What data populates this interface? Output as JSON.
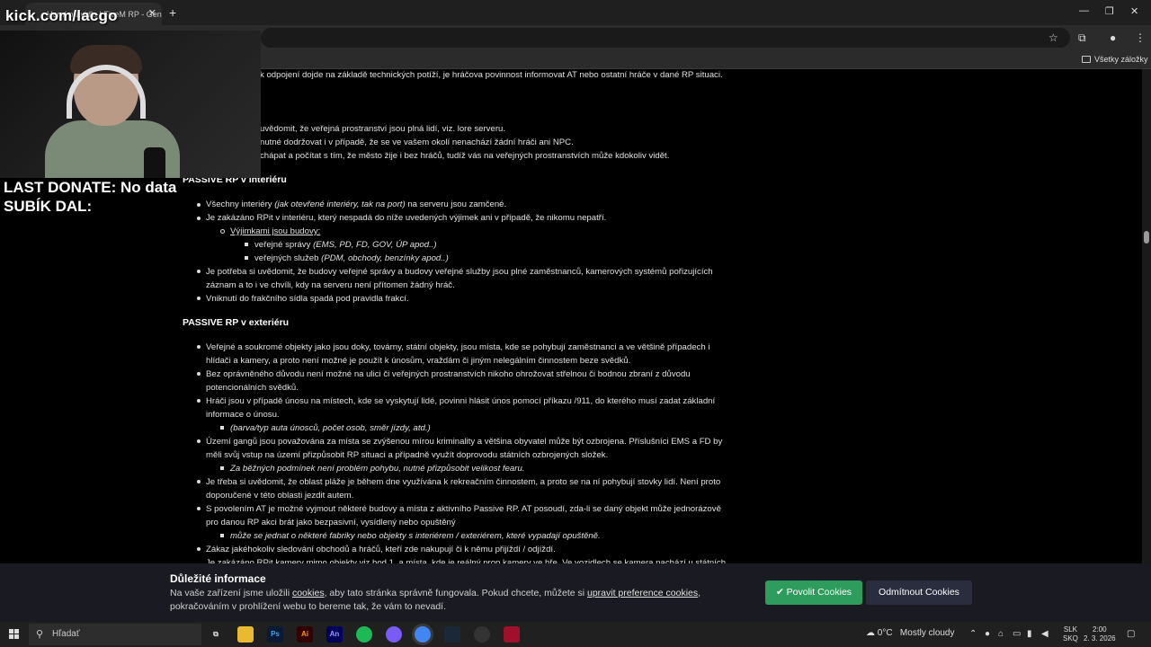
{
  "browser": {
    "tab_title": "Herní pravidla | FiveM RP - Gen",
    "bookmarks_all": "Všetky záložky"
  },
  "overlay": {
    "channel": "kick.com/lacgo",
    "donate_line": "LAST DONATE: No data",
    "sub_line": "SUBÍK DAL:"
  },
  "article": {
    "top_line": "k odpojení dojde na základě technických potíží, je hráčova povinnost informovat AT nebo ostatní hráče v dané RP situaci.",
    "public_lines": [
      "uvědomit, že veřejná prostranství jsou plná lidí, viz. lore serveru.",
      "nutné dodržovat i v případě, že se ve vašem okolí nenachází žádní hráči ani NPC.",
      "chápat a počítat s tím, že město žije i bez hráčů, tudíž vás na veřejných prostranstvích může kdokoliv vidět."
    ],
    "interior_heading": "PASSIVE RP v interiéru",
    "interior": {
      "b1_text": "Všechny interiéry ",
      "b1_italic": "(jak otevřené interiéry, tak na port)",
      "b1_tail": " na serveru jsou zamčené.",
      "b2": "Je zakázáno RPit v interiéru, který nespadá do níže uvedených výjimek ani v případě, že nikomu nepatří.",
      "exceptions_label": "Výjimkami jsou budovy:",
      "ex1_text": "veřejné správy ",
      "ex1_italic": "(EMS, PD, FD, GOV, ÚP apod..)",
      "ex2_text": "veřejných služeb ",
      "ex2_italic": "(PDM, obchody, benzínky apod..)",
      "b3_l1": "Je potřeba si uvědomit, že budovy veřejné správy a budovy veřejné služby jsou plné zaměstnanců, kamerových systémů pořizujících",
      "b3_l2": "záznam a to i ve chvíli, kdy na serveru není přítomen žádný hráč.",
      "b4": "Vniknutí do frakčního sídla spadá pod pravidla frakcí."
    },
    "exterior_heading": "PASSIVE RP v exteriéru",
    "exterior": {
      "e1_l1": "Veřejné a soukromé objekty jako jsou doky, továrny, státní objekty, jsou místa, kde se pohybují zaměstnanci a ve většině případech i",
      "e1_l2": "hlídači a kamery, a proto není možné je použít k únosům, vraždám či jiným nelegálním činnostem beze svědků.",
      "e2_l1": "Bez oprávněného důvodu není možné na ulici či veřejných prostranstvích nikoho ohrožovat střelnou či bodnou zbraní z důvodu",
      "e2_l2": "potencionálních svědků.",
      "e3_l1": "Hráči jsou v případě únosu na místech, kde se vyskytují lidé, povinni hlásit únos pomocí příkazu /911, do kterého musí zadat základní",
      "e3_l2": "informace o únosu.",
      "e3_sub": "(barva/typ auta únosců, počet osob, směr jízdy, atd.)",
      "e4_l1": "Území gangů jsou považována za místa se zvýšenou mírou kriminality a většina obyvatel může být ozbrojena. Příslušníci EMS a FD by",
      "e4_l2": "měli svůj vstup na území přizpůsobit RP situaci a případně využít doprovodu státních ozbrojených složek.",
      "e4_sub": "Za běžných podmínek není problém pohybu, nutné přizpůsobit velikost fearu.",
      "e5_l1": "Je třeba si uvědomit, že oblast pláže je během dne využívána k rekreačním činnostem, a proto se na ní pohybují stovky lidí. Není proto",
      "e5_l2": "doporučené v této oblasti jezdit autem.",
      "e6_l1": "S povolením AT je možné vyjmout některé budovy a místa z aktivního Passive RP. AT posoudí, zda-li se daný objekt může jednorázově",
      "e6_l2": "pro danou RP akci brát jako bezpasivní, vysídlený nebo opuštěný",
      "e6_sub": "může se jednat o některé fabriky nebo objekty s interiérem / exteriérem, které vypadají opuštěně.",
      "e7": "Zákaz jakéhokoliv sledování obchodů a hráčů, kteří zde nakupují či k němu přijíždí / odjíždí.",
      "e8": "Je zakázáno RPit kamery mimo objekty viz bod 1, a místa, kde je reálný prop kamery ve hře. Ve vozidlech se kamera nachází u státních"
    }
  },
  "cookie": {
    "title": "Důležité informace",
    "t1": "Na vaše zařízení jsme uložili ",
    "link1": "cookies",
    "t2": ", aby tato stránka správně fungovala. Pokud chcete, můžete si ",
    "link2": "upravit preference cookies",
    "t3": ",",
    "t4": "pokračováním v prohlížení webu to bereme tak, že vám to nevadí.",
    "allow": "Povolit Cookies",
    "deny": "Odmítnout Cookies"
  },
  "taskbar": {
    "search_placeholder": "Hľadať",
    "apps": [
      "Ps",
      "Ai",
      "An"
    ],
    "weather_temp": "0°C",
    "weather_text": "Mostly cloudy",
    "lang1": "SLK",
    "lang2": "SKQ",
    "time": "2:00",
    "date": "2. 3. 2026"
  }
}
